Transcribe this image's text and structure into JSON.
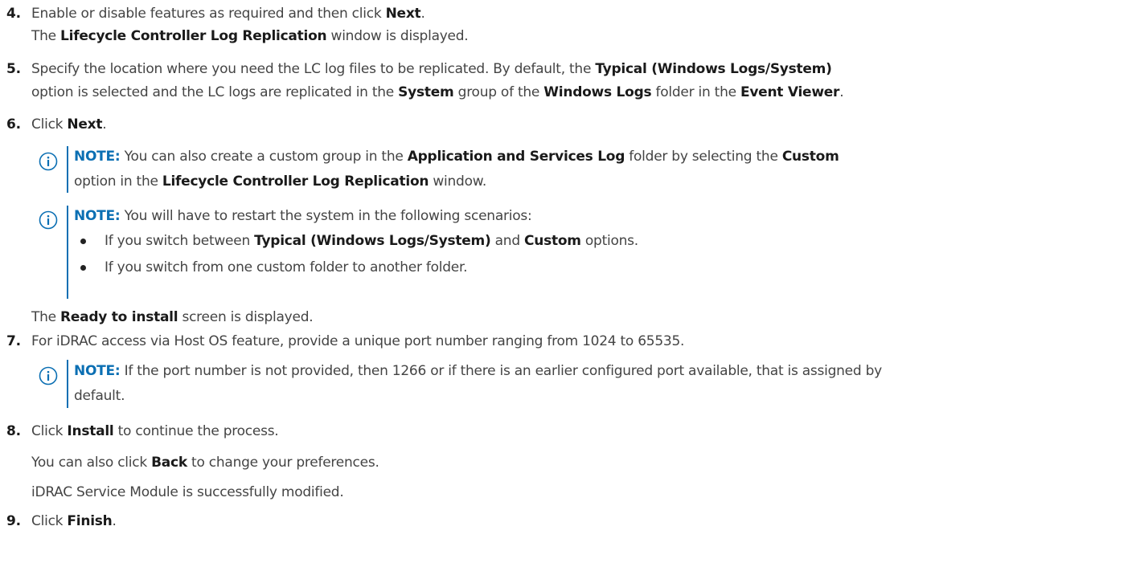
{
  "note_label": "NOTE:",
  "steps": [
    {
      "num": "4.",
      "lines": [
        [
          "Enable or disable features as required and then click ",
          {
            "b": "Next"
          },
          "."
        ],
        [
          "The ",
          {
            "b": "Lifecycle Controller Log Replication"
          },
          " window is displayed."
        ]
      ]
    },
    {
      "num": "5.",
      "lines": [
        [
          "Specify the location where you need the LC log files to be replicated. By default, the ",
          {
            "b": "Typical (Windows Logs/System)"
          }
        ],
        [
          "option is selected and the LC logs are replicated in the ",
          {
            "b": "System"
          },
          " group of the ",
          {
            "b": "Windows Logs"
          },
          " folder in the ",
          {
            "b": "Event Viewer"
          },
          "."
        ]
      ]
    },
    {
      "num": "6.",
      "lines": [
        [
          "Click ",
          {
            "b": "Next"
          },
          "."
        ]
      ]
    },
    {
      "num": "7.",
      "lines": [
        [
          "For iDRAC access via Host OS feature, provide a unique port number ranging from 1024 to 65535."
        ]
      ]
    },
    {
      "num": "8.",
      "lines": [
        [
          "Click ",
          {
            "b": "Install"
          },
          " to continue the process."
        ]
      ]
    },
    {
      "num": "9.",
      "lines": [
        [
          "Click ",
          {
            "b": "Finish"
          },
          "."
        ]
      ]
    }
  ],
  "notes": [
    {
      "lines": [
        [
          " You can also create a custom group in the ",
          {
            "b": "Application and Services Log"
          },
          " folder by selecting the ",
          {
            "b": "Custom"
          }
        ],
        [
          "option in the ",
          {
            "b": "Lifecycle Controller Log Replication"
          },
          " window."
        ]
      ]
    },
    {
      "lines": [
        [
          " You will have to restart the system in the following scenarios:"
        ]
      ],
      "bullets": [
        [
          "If you switch between ",
          {
            "b": "Typical (Windows Logs/System)"
          },
          " and ",
          {
            "b": "Custom"
          },
          " options."
        ],
        [
          "If you switch from one custom folder to another folder."
        ]
      ]
    },
    {
      "lines": [
        [
          " If the port number is not provided, then 1266 or if there is an earlier configured port available, that is assigned by"
        ],
        [
          "default."
        ]
      ]
    }
  ],
  "paras": [
    [
      "The ",
      {
        "b": "Ready to install"
      },
      " screen is displayed."
    ],
    [
      "You can also click ",
      {
        "b": "Back"
      },
      " to change your preferences."
    ],
    [
      "iDRAC Service Module is successfully modified."
    ]
  ]
}
